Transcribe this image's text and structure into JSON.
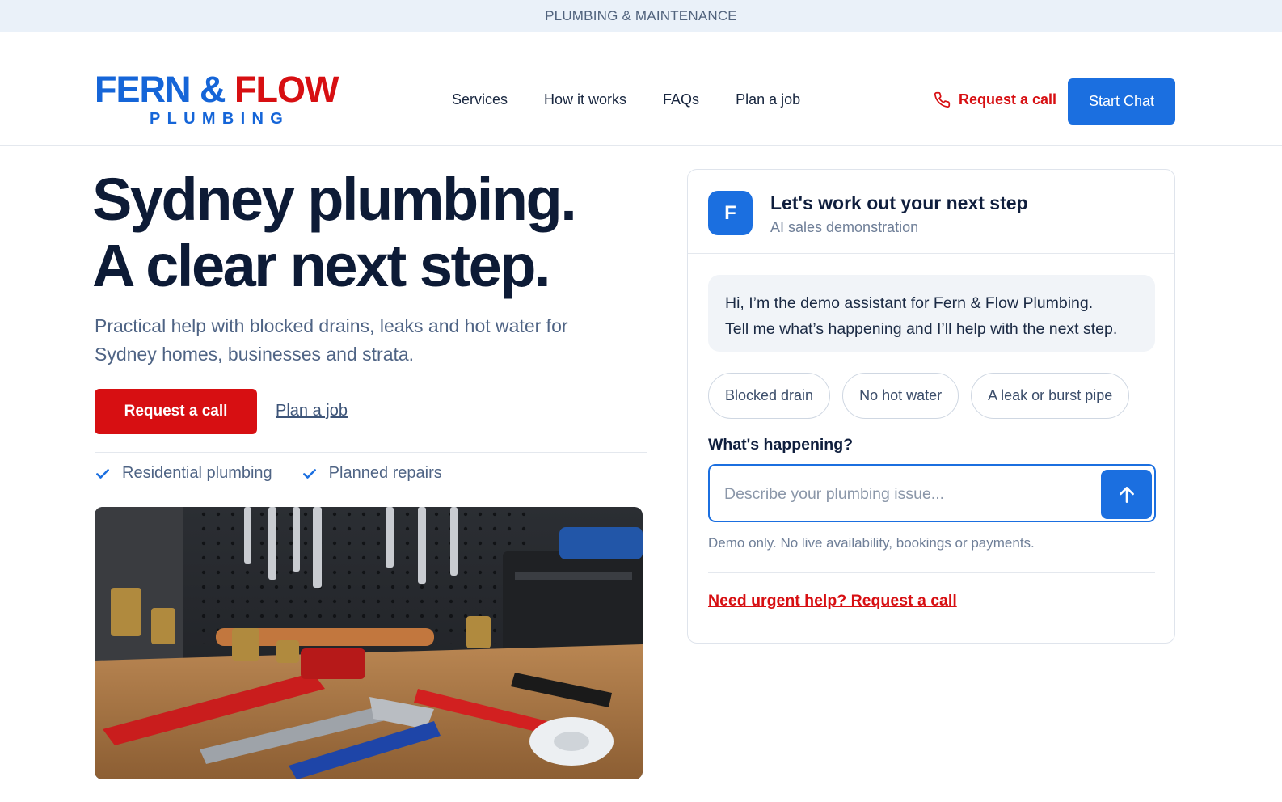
{
  "topbar": {
    "text": "PLUMBING & MAINTENANCE"
  },
  "brand": {
    "name_part1": "FERN &",
    "name_part2": "FLOW",
    "tagline": "PLUMBING"
  },
  "nav": {
    "items": [
      "Services",
      "How it works",
      "FAQs",
      "Plan a job"
    ],
    "request_call": "Request a call",
    "start_chat": "Start Chat"
  },
  "hero": {
    "title_line1": "Sydney plumbing.",
    "title_line2": "A clear next step.",
    "subtitle": "Practical help with blocked drains, leaks and hot water for Sydney homes, businesses and strata.",
    "cta_primary": "Request a call",
    "cta_secondary": "Plan a job",
    "checks": [
      "Residential plumbing",
      "Planned repairs"
    ]
  },
  "chat": {
    "avatar_letter": "F",
    "title": "Let's work out your next step",
    "subtitle": "AI sales demonstration",
    "greeting_line1": "Hi, I’m the demo assistant for Fern & Flow Plumbing.",
    "greeting_line2": "Tell me what’s happening and I’ll help with the next step.",
    "chips": [
      "Blocked drain",
      "No hot water",
      "A leak or burst pipe"
    ],
    "question_label": "What's happening?",
    "input_placeholder": "Describe your plumbing issue...",
    "input_value": "",
    "disclaimer": "Demo only. No live availability, bookings or payments.",
    "urgent_link": "Need urgent help? Request a call"
  },
  "icons": {
    "phone": "phone-icon",
    "check": "check-icon",
    "send": "arrow-up-icon"
  },
  "colors": {
    "brand_blue": "#1b6fe0",
    "brand_red": "#d70f12",
    "heading": "#0d1b36",
    "topbar_bg": "#eaf1f9"
  }
}
